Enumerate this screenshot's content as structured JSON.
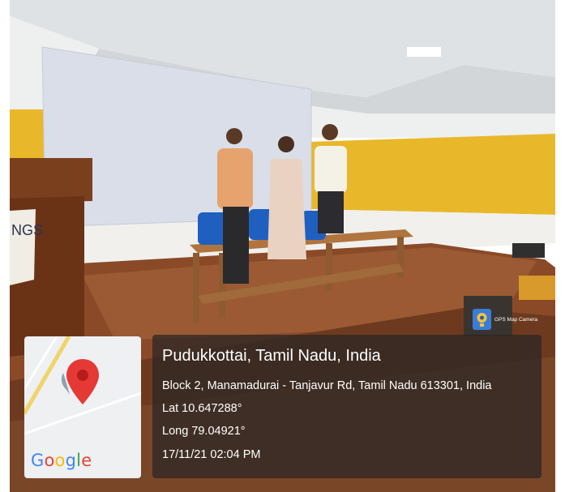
{
  "location": {
    "title": "Pudukkottai, Tamil Nadu, India",
    "address": "Block 2, Manamadurai - Tanjavur Rd, Tamil Nadu 613301, India",
    "lat": "Lat 10.647288°",
    "long": "Long 79.04921°",
    "datetime": "17/11/21 02:04 PM"
  },
  "map": {
    "brand": "Google"
  },
  "badge": {
    "label": "GPS Map Camera"
  },
  "podium": {
    "emblem_text": "NGS"
  },
  "colors": {
    "wall_yellow": "#e8b82a",
    "stage_wood": "#8a4a28",
    "pin_red": "#e53935",
    "overlay": "#282624"
  },
  "icons": [
    "map-pin-icon",
    "gps-camera-icon"
  ]
}
